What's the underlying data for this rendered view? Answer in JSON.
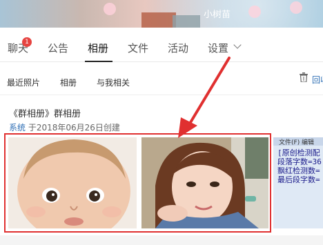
{
  "banner": {
    "group_name": "小树苗"
  },
  "tabs": [
    {
      "label": "聊天",
      "badge": "1"
    },
    {
      "label": "公告"
    },
    {
      "label": "相册"
    },
    {
      "label": "文件"
    },
    {
      "label": "活动"
    },
    {
      "label": "设置"
    }
  ],
  "subnav": {
    "items": [
      "最近照片",
      "相册",
      "与我相关"
    ],
    "recycle_label": "回收"
  },
  "album": {
    "title": "《群相册》群相册",
    "creator": "系统",
    "created": "于2018年06月26日创建"
  },
  "doc_preview": {
    "menu": "文件(F)  编辑",
    "lines": [
      "[原创检测配",
      "段落字数=36",
      "飘红检测数=",
      "最后段字数="
    ]
  },
  "colors": {
    "accent_link": "#2f6fb5",
    "badge": "#e64340",
    "highlight": "#e03030"
  }
}
